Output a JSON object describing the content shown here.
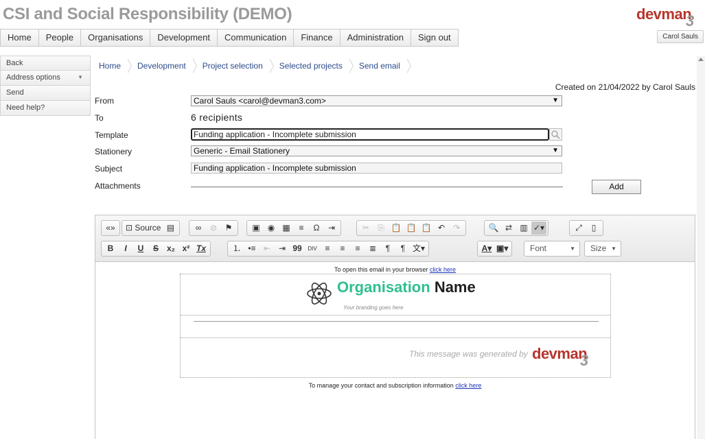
{
  "app": {
    "title": "CSI and Social Responsibility (DEMO)",
    "logo_text": "devman",
    "logo_suffix": "3",
    "user": "Carol Sauls"
  },
  "menu": [
    "Home",
    "People",
    "Organisations",
    "Development",
    "Communication",
    "Finance",
    "Administration",
    "Sign out"
  ],
  "sidebar": [
    {
      "label": "Back"
    },
    {
      "label": "Address options",
      "caret": "▼"
    },
    {
      "label": "Send"
    },
    {
      "label": "Need help?"
    }
  ],
  "breadcrumb": [
    "Home",
    "Development",
    "Project selection",
    "Selected projects",
    "Send email"
  ],
  "created": "Created on 21/04/2022 by Carol Sauls",
  "form": {
    "from_label": "From",
    "from_value": "Carol Sauls <carol@devman3.com>",
    "to_label": "To",
    "to_value": "6 recipients",
    "template_label": "Template",
    "template_value": "Funding application - Incomplete submission",
    "stationery_label": "Stationery",
    "stationery_value": "Generic - Email Stationery",
    "subject_label": "Subject",
    "subject_value": "Funding application - Incomplete submission",
    "attachments_label": "Attachments",
    "add_label": "Add"
  },
  "editor": {
    "source_label": "Source",
    "font_label": "Font",
    "size_label": "Size",
    "icons_row1": [
      "template-tags-icon",
      "source-icon",
      "preview-icon",
      "link-icon",
      "unlink-icon",
      "anchor-icon",
      "image-icon",
      "flash-icon",
      "table-icon",
      "horizontal-rule-icon",
      "special-char-icon",
      "page-break-icon",
      "cut-icon",
      "copy-icon",
      "paste-icon",
      "paste-text-icon",
      "paste-word-icon",
      "undo-icon",
      "redo-icon",
      "find-icon",
      "replace-icon",
      "select-all-icon",
      "spellcheck-icon",
      "maximize-icon",
      "show-blocks-icon"
    ],
    "icons_row2": [
      "bold-icon",
      "italic-icon",
      "underline-icon",
      "strike-icon",
      "subscript-icon",
      "superscript-icon",
      "remove-format-icon",
      "numbered-list-icon",
      "bulleted-list-icon",
      "outdent-icon",
      "indent-icon",
      "blockquote-icon",
      "div-icon",
      "align-left-icon",
      "align-center-icon",
      "align-right-icon",
      "justify-icon",
      "ltr-icon",
      "rtl-icon",
      "language-icon",
      "text-color-icon",
      "bg-color-icon"
    ]
  },
  "preview": {
    "open_text": "To open this email in your browser",
    "open_link": "click here",
    "org_first": "Organisation",
    "org_second": "Name",
    "tagline": "Your branding goes here",
    "generated_text": "This message was generated by",
    "generated_logo": "devman",
    "generated_logo_suffix": "3",
    "manage_text": "To manage your contact and subscription information",
    "manage_link": "click here"
  },
  "colors": {
    "brand": "#b7342b",
    "accent": "#2fbf8f",
    "link": "#1a33b8"
  }
}
